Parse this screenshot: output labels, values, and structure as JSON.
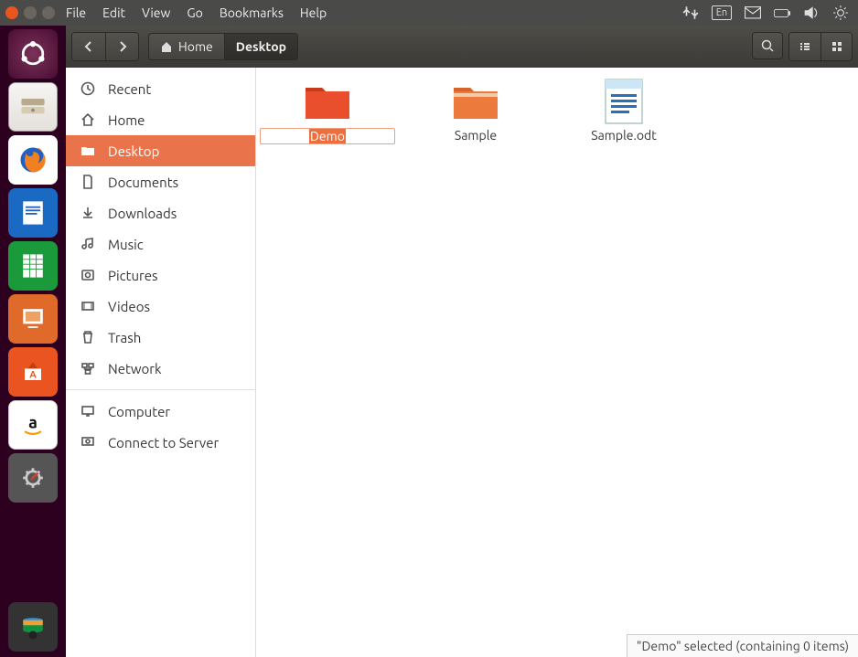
{
  "menubar": {
    "items": [
      "File",
      "Edit",
      "View",
      "Go",
      "Bookmarks",
      "Help"
    ],
    "indicator_lang": "En"
  },
  "toolbar": {
    "path": [
      "Home",
      "Desktop"
    ]
  },
  "sidebar": {
    "items": [
      {
        "label": "Recent",
        "active": false
      },
      {
        "label": "Home",
        "active": false
      },
      {
        "label": "Desktop",
        "active": true
      },
      {
        "label": "Documents",
        "active": false
      },
      {
        "label": "Downloads",
        "active": false
      },
      {
        "label": "Music",
        "active": false
      },
      {
        "label": "Pictures",
        "active": false
      },
      {
        "label": "Videos",
        "active": false
      },
      {
        "label": "Trash",
        "active": false
      },
      {
        "label": "Network",
        "active": false
      }
    ],
    "items2": [
      {
        "label": "Computer"
      },
      {
        "label": "Connect to Server"
      }
    ]
  },
  "content": {
    "items": [
      {
        "name": "Demo",
        "type": "folder",
        "editing": true,
        "color": "#e94f2d"
      },
      {
        "name": "Sample",
        "type": "folder",
        "editing": false,
        "color": "#ec7a3c"
      },
      {
        "name": "Sample.odt",
        "type": "odt",
        "editing": false
      }
    ]
  },
  "status": {
    "text": "\"Demo\" selected  (containing 0 items)"
  }
}
